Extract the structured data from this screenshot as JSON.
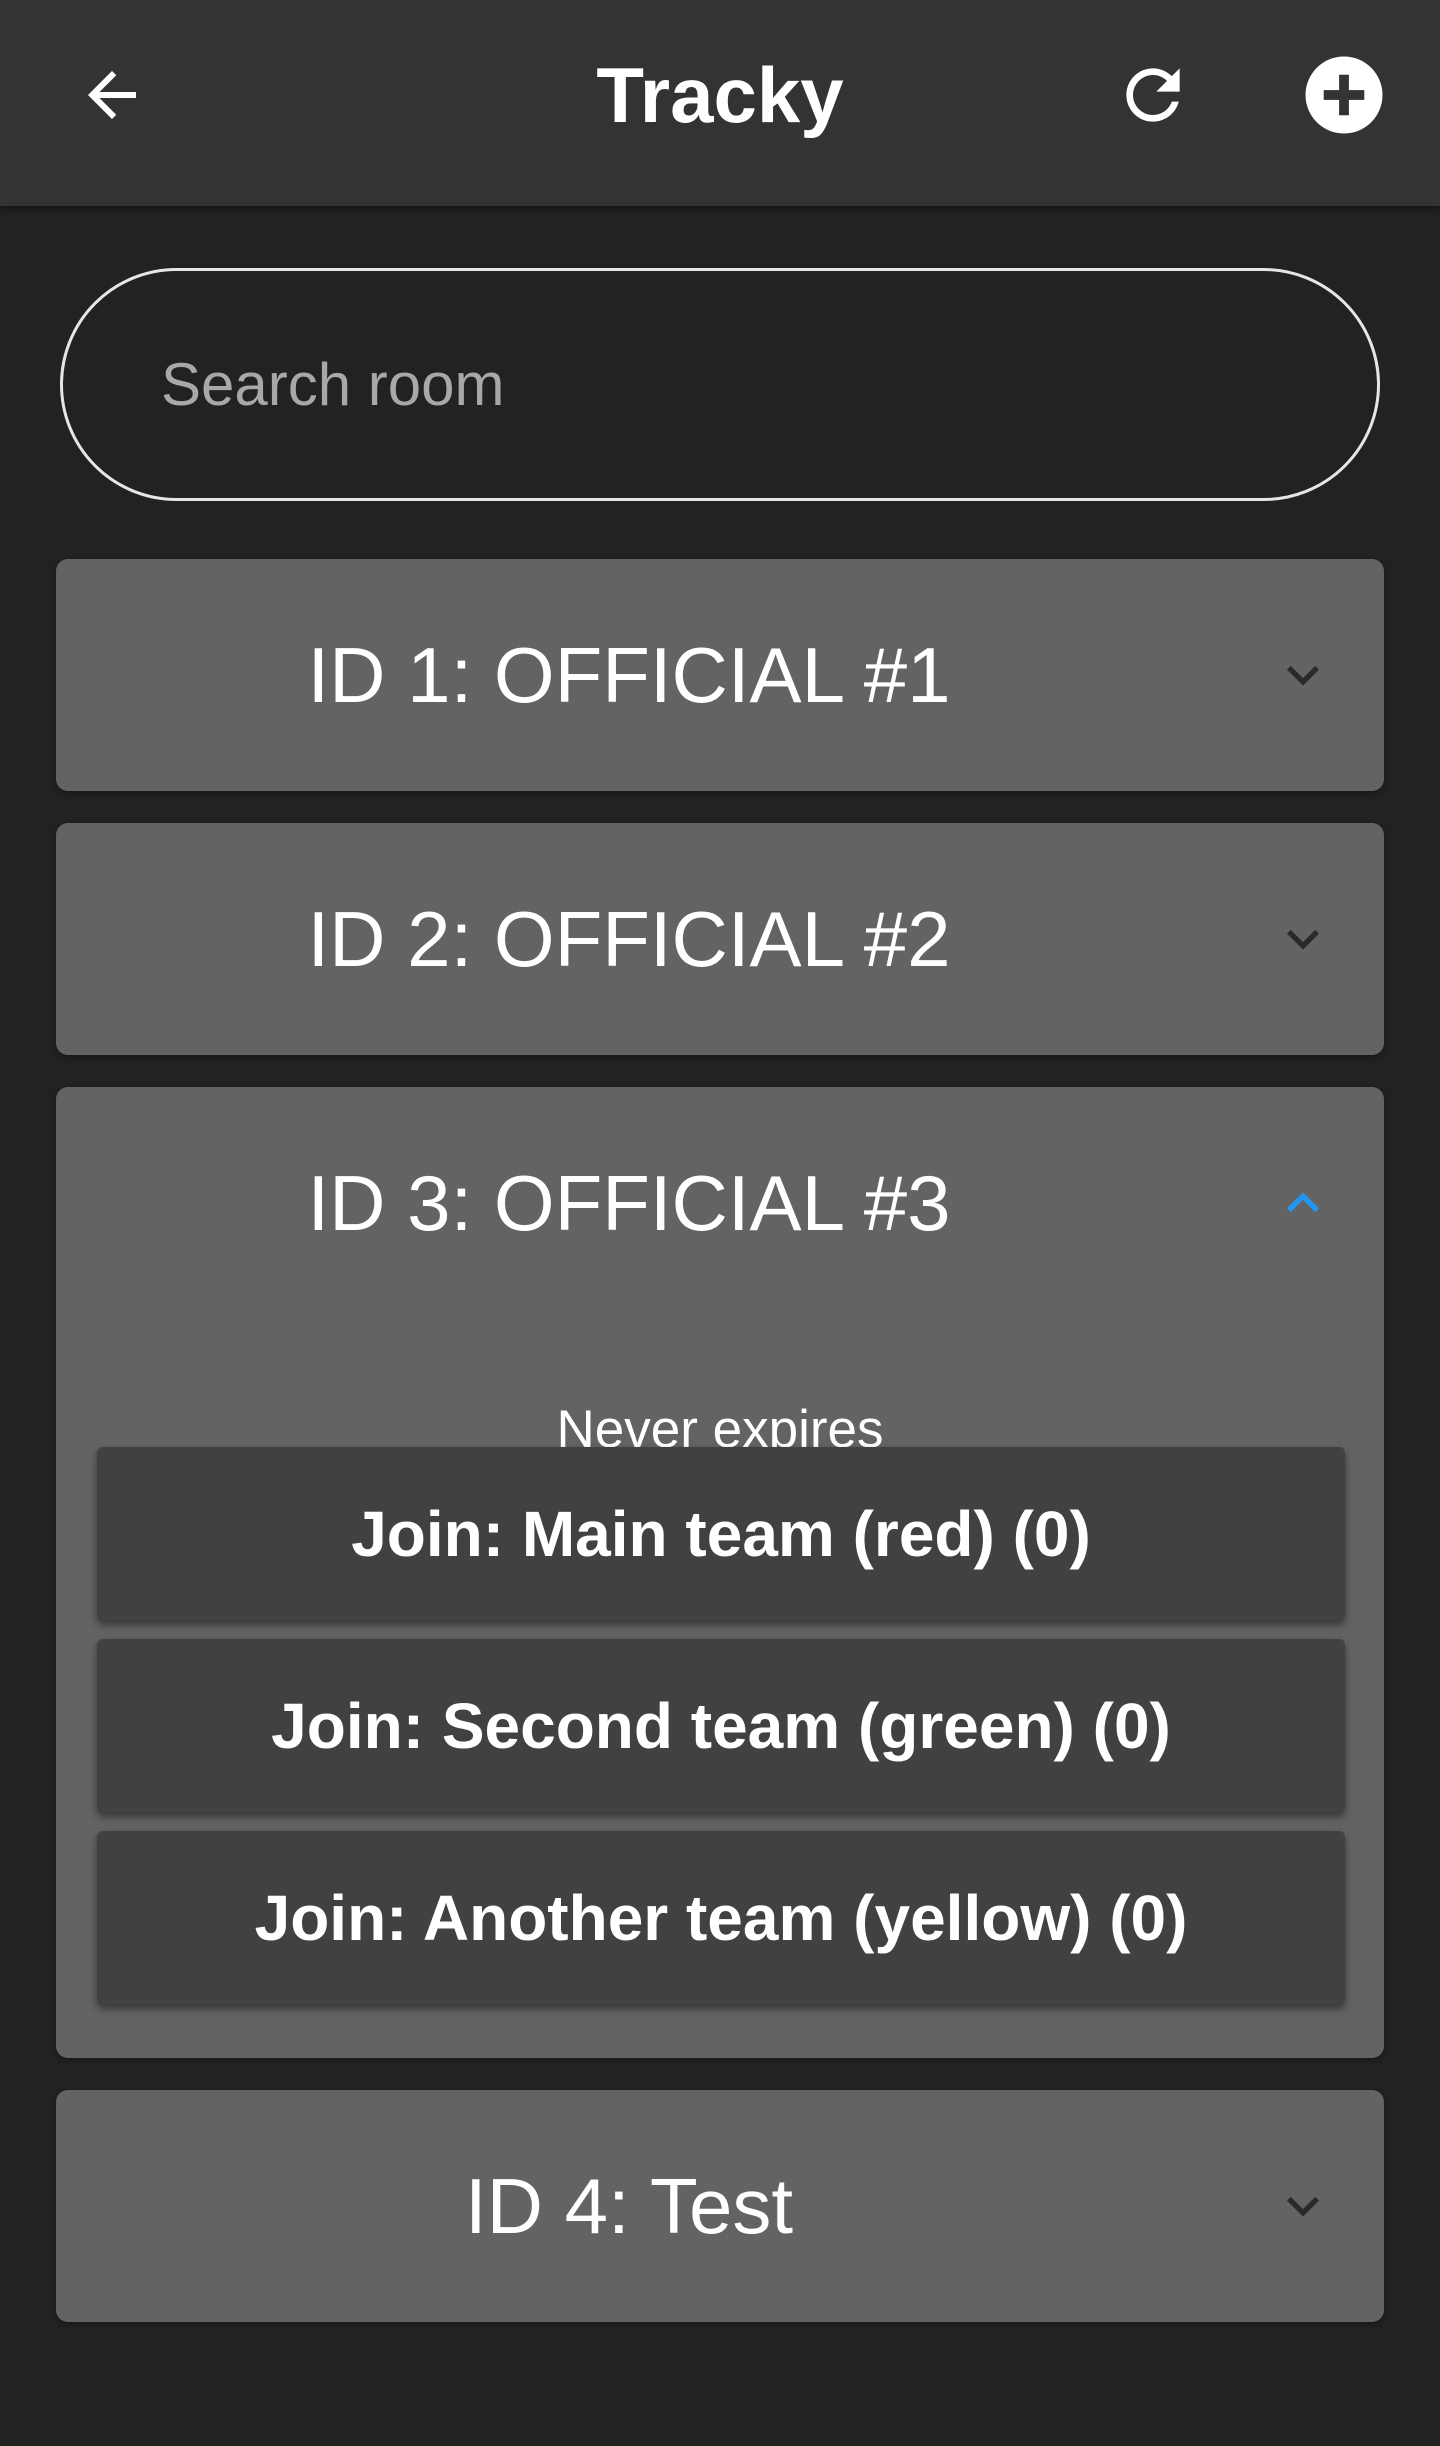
{
  "app_bar": {
    "title": "Tracky",
    "back_icon": "arrow-left-icon",
    "refresh_icon": "refresh-icon",
    "add_icon": "plus-circle-icon"
  },
  "search": {
    "placeholder": "Search room",
    "value": ""
  },
  "rooms": [
    {
      "label": "ID 1: OFFICIAL #1",
      "expanded": false,
      "chevron_icon": "chevron-down-icon"
    },
    {
      "label": "ID 2: OFFICIAL #2",
      "expanded": false,
      "chevron_icon": "chevron-down-icon"
    },
    {
      "label": "ID 3: OFFICIAL #3",
      "expanded": true,
      "chevron_icon": "chevron-up-icon",
      "expiry": "Never expires",
      "teams": [
        {
          "label": "Join: Main team (red) (0)"
        },
        {
          "label": "Join: Second team (green) (0)"
        },
        {
          "label": "Join: Another team (yellow) (0)"
        }
      ]
    },
    {
      "label": "ID 4: Test",
      "expanded": false,
      "chevron_icon": "chevron-down-icon"
    }
  ],
  "colors": {
    "background": "#222222",
    "app_bar": "#333333",
    "card": "#636363",
    "join_button": "#414141",
    "accent": "#2196F3"
  }
}
